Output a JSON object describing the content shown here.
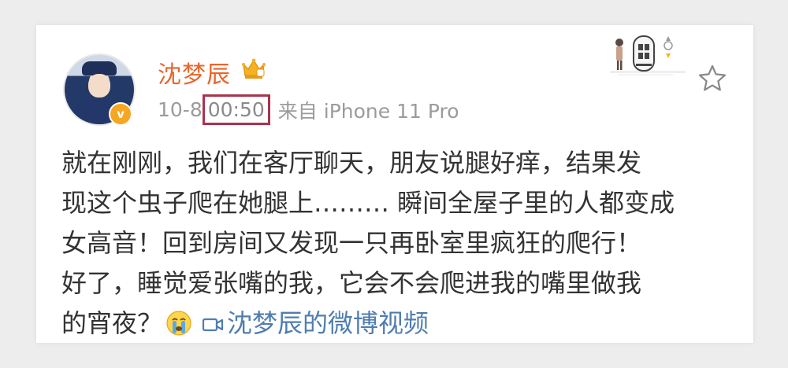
{
  "post": {
    "username": "沈梦辰",
    "date": "10-8",
    "time": "00:50",
    "source": "来自 iPhone 11 Pro",
    "lines": [
      "就在刚刚，我们在客厅聊天，朋友说腿好痒，结果发",
      "现这个虫子爬在她腿上……… 瞬间全屋子里的人都变成",
      "女高音！回到房间又发现一只再卧室里疯狂的爬行！",
      "好了，睡觉爱张嘴的我，它会不会爬进我的嘴里做我",
      "的宵夜？"
    ],
    "video_link": "沈梦辰的微博视频",
    "verified_badge": "v"
  },
  "icons": {
    "crown": "crown-icon",
    "favorite": "star-outline-icon",
    "emoji": "crying-emoji-icon",
    "video": "video-camera-icon"
  },
  "colors": {
    "username": "#e8652b",
    "highlight_box": "#a8344e",
    "link": "#4f7db0",
    "body_text": "#333333",
    "meta_text": "#9b9b9b"
  }
}
